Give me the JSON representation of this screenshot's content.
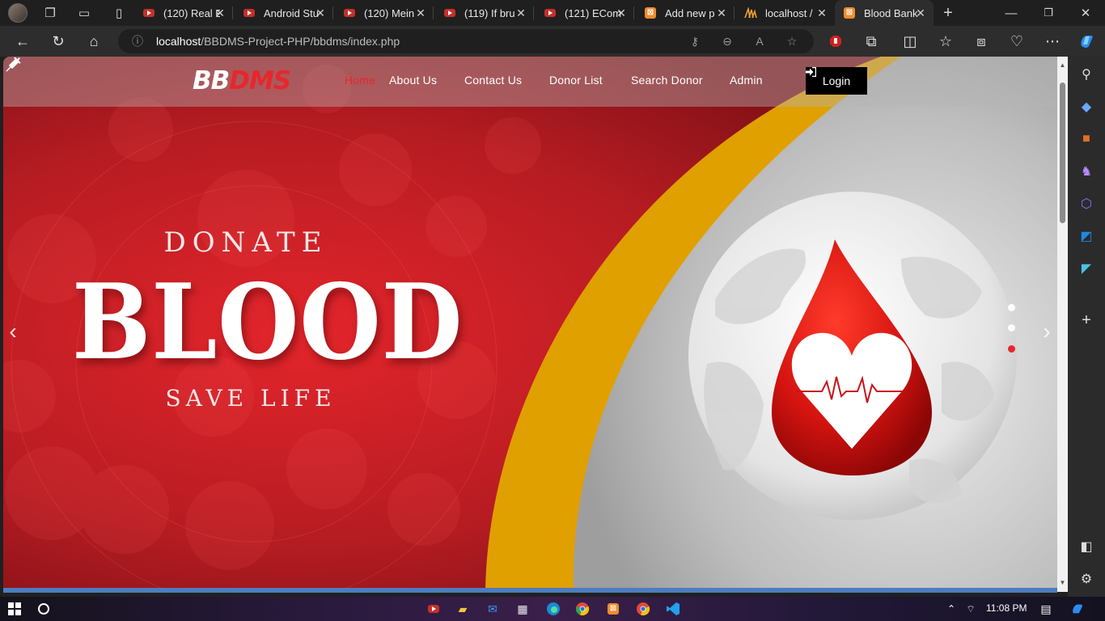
{
  "browser": {
    "tabs": [
      {
        "title": "(120) Real E",
        "icon": "youtube-icon"
      },
      {
        "title": "Android Stu",
        "icon": "youtube-icon"
      },
      {
        "title": "(120) Mein",
        "icon": "youtube-icon"
      },
      {
        "title": "(119) If bru",
        "icon": "youtube-icon"
      },
      {
        "title": "(121) ECom",
        "icon": "youtube-icon"
      },
      {
        "title": "Add new p",
        "icon": "xampp-icon"
      },
      {
        "title": "localhost /",
        "icon": "phpmyadmin-icon"
      },
      {
        "title": "Blood Bank",
        "icon": "xampp-icon"
      }
    ],
    "url_host": "localhost",
    "url_path": "/BBDMS-Project-PHP/bbdms/index.php"
  },
  "site": {
    "brand_white": "BB",
    "brand_red": "DMS",
    "nav": [
      "Home",
      "About Us",
      "Contact Us",
      "Donor List",
      "Search Donor",
      "Admin"
    ],
    "login_label": "Login",
    "hero": {
      "line1": "DONATE",
      "line2": "BLOOD",
      "line3": "SAVE LIFE"
    },
    "carousel": {
      "slides": 3,
      "active_index": 2
    }
  },
  "taskbar": {
    "time": "11:08 PM"
  },
  "colors": {
    "accent_red": "#e8262d",
    "hero_red": "#b31a20",
    "gold": "#e0a000"
  }
}
